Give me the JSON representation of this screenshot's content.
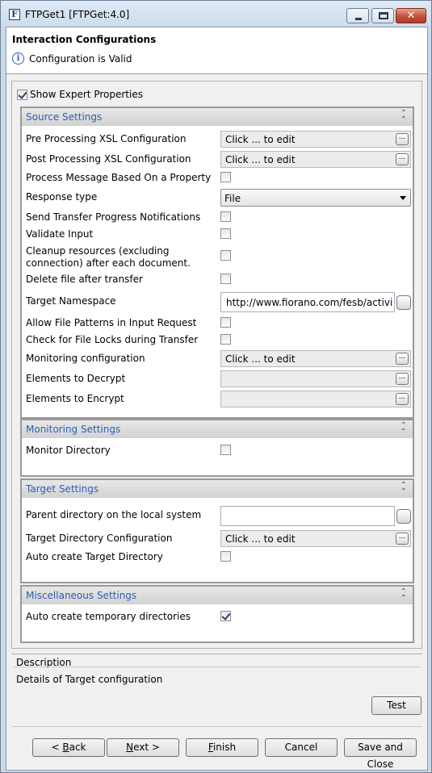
{
  "window": {
    "title": "FTPGet1 [FTPGet:4.0]",
    "app_icon_letter": "F"
  },
  "header": {
    "title": "Interaction Configurations",
    "status": "Configuration is Valid"
  },
  "expert": {
    "label": "Show Expert Properties",
    "checked": true
  },
  "sections": {
    "source": {
      "title": "Source Settings",
      "pre_xsl": {
        "label": "Pre Processing XSL Configuration",
        "value": "Click ... to edit"
      },
      "post_xsl": {
        "label": "Post Processing XSL Configuration",
        "value": "Click ... to edit"
      },
      "process_prop": {
        "label": "Process Message Based On a Property",
        "checked": false
      },
      "response_type": {
        "label": "Response type",
        "value": "File"
      },
      "send_progress": {
        "label": "Send Transfer Progress Notifications",
        "checked": false
      },
      "validate": {
        "label": "Validate Input",
        "checked": false
      },
      "cleanup": {
        "label": "Cleanup resources (excluding connection) after each document.",
        "checked": false
      },
      "delete_file": {
        "label": "Delete file after transfer",
        "checked": false
      },
      "target_ns": {
        "label": "Target Namespace",
        "value": "http://www.fiorano.com/fesb/activity/"
      },
      "allow_patterns": {
        "label": "Allow File Patterns in Input Request",
        "checked": false
      },
      "check_locks": {
        "label": "Check for File Locks during Transfer",
        "checked": false
      },
      "monitoring_cfg": {
        "label": "Monitoring configuration",
        "value": "Click ... to edit"
      },
      "decrypt": {
        "label": "Elements to Decrypt",
        "value": ""
      },
      "encrypt": {
        "label": "Elements to Encrypt",
        "value": ""
      }
    },
    "monitoring": {
      "title": "Monitoring Settings",
      "monitor_dir": {
        "label": "Monitor Directory",
        "checked": false
      }
    },
    "target": {
      "title": "Target Settings",
      "parent_dir": {
        "label": "Parent directory on the local system",
        "value": ""
      },
      "target_dir_cfg": {
        "label": "Target Directory Configuration",
        "value": "Click ... to edit"
      },
      "auto_create": {
        "label": "Auto create Target Directory",
        "checked": false
      }
    },
    "misc": {
      "title": "Miscellaneous Settings",
      "auto_temp": {
        "label": "Auto create temporary directories",
        "checked": true
      }
    }
  },
  "description": {
    "title": "Description",
    "text": "Details of Target configuration"
  },
  "buttons": {
    "test": "Test",
    "back_pre": "< ",
    "back_key": "B",
    "back_post": "ack",
    "next_key": "N",
    "next_post": "ext >",
    "finish_key": "F",
    "finish_post": "inish",
    "cancel": "Cancel",
    "save_close": "Save and Close"
  },
  "dots_label": "..."
}
